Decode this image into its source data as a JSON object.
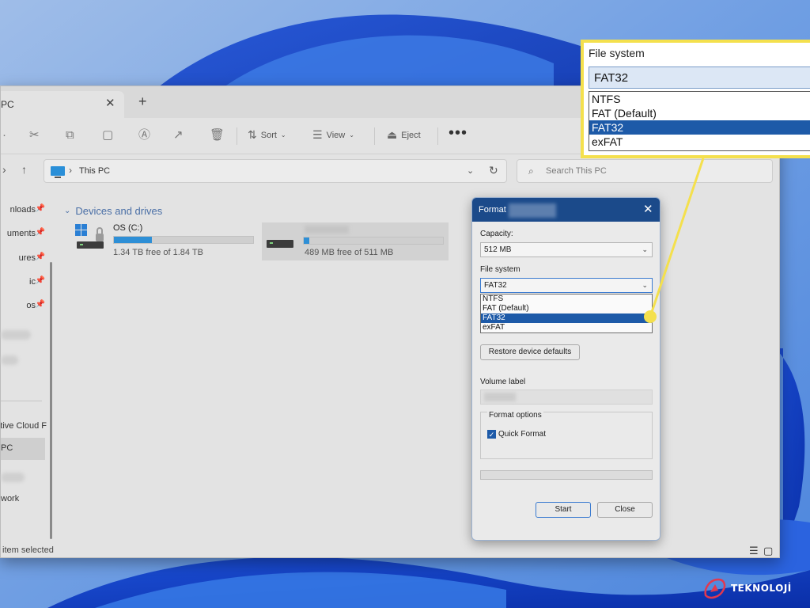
{
  "window": {
    "tab_title": "PC",
    "tab_close_icon": "close-icon",
    "new_tab_icon": "plus-icon"
  },
  "toolbar": {
    "cut_icon": "scissors-icon",
    "copy_icon": "copy-icon",
    "paste_icon": "paste-icon",
    "rename_icon": "rename-icon",
    "share_icon": "share-icon",
    "delete_icon": "trash-icon",
    "sort_label": "Sort",
    "view_label": "View",
    "eject_label": "Eject",
    "more_label": "•••"
  },
  "address": {
    "path": "This PC",
    "search_placeholder": "Search This PC"
  },
  "sidebar": {
    "items": [
      {
        "label": "nloads",
        "pinned": true
      },
      {
        "label": "uments",
        "pinned": true
      },
      {
        "label": "ures",
        "pinned": true
      },
      {
        "label": "ic",
        "pinned": true
      },
      {
        "label": "os",
        "pinned": true
      },
      {
        "label": "tive Cloud F",
        "pinned": false
      },
      {
        "label": "PC",
        "pinned": false,
        "selected": true
      },
      {
        "label": "work",
        "pinned": false
      }
    ]
  },
  "main": {
    "section_title": "Devices and drives",
    "drives": [
      {
        "name": "OS (C:)",
        "free_text": "1.34 TB free of 1.84 TB",
        "used_fraction": 0.27
      },
      {
        "name": "",
        "free_text": "489 MB free of 511 MB",
        "used_fraction": 0.04
      }
    ]
  },
  "status": {
    "text": "item selected"
  },
  "format_dialog": {
    "title": "Format",
    "capacity_label": "Capacity:",
    "capacity_value": "512 MB",
    "filesystem_label": "File system",
    "filesystem_value": "FAT32",
    "filesystem_options": [
      "NTFS",
      "FAT (Default)",
      "FAT32",
      "exFAT"
    ],
    "selected_option": "FAT32",
    "restore_label": "Restore device defaults",
    "volume_label": "Volume label",
    "format_options_label": "Format options",
    "quick_format_label": "Quick Format",
    "quick_format_checked": true,
    "progress": 0,
    "start_label": "Start",
    "close_label": "Close"
  },
  "zoom": {
    "label": "File system",
    "value": "FAT32",
    "options": [
      "NTFS",
      "FAT (Default)",
      "FAT32",
      "exFAT"
    ],
    "selected_option": "FAT32",
    "highlight_color": "#f4e04d"
  },
  "watermark": {
    "text": "TEKNOLOJİ"
  },
  "colors": {
    "accent": "#1d5aa8",
    "drive_fill": "#2e8fd6",
    "dialog_title": "#1b4a8a",
    "callout": "#f4e04d"
  }
}
